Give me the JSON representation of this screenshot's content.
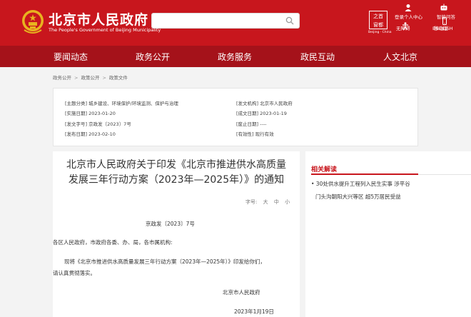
{
  "header": {
    "site_title": "北京市人民政府",
    "site_subtitle": "The People's Government of Beijing Municipality",
    "search_placeholder": "",
    "logo_chars": [
      "首",
      "之",
      "都",
      "窗"
    ],
    "logo_caption": "Beijing · China",
    "links": {
      "login": "登录个人中心",
      "accessible": "无障碍",
      "smart_q": "智能问答",
      "mobile": "移动版",
      "english": "ENGLISH"
    }
  },
  "nav": [
    "要闻动态",
    "政务公开",
    "政务服务",
    "政民互动",
    "人文北京"
  ],
  "breadcrumb": [
    "政务公开",
    "政策公开",
    "政策文件"
  ],
  "meta": {
    "topic": "[主题分类] 城乡建设、环境保护/环境监测、保护与治理",
    "issuer": "[发文机构] 北京市人民政府",
    "implement_date": "[实施日期] 2023-01-20",
    "written_date": "[成文日期] 2023-01-19",
    "doc_number": "[发文字号] 京政发〔2023〕7号",
    "abolish_date": "[废止日期] ----",
    "publish_date": "[发布日期] 2023-02-10",
    "validity": "[有效性] 现行有效"
  },
  "doc": {
    "title_line1": "北京市人民政府关于印发《北京市推进供水高质量",
    "title_line2": "发展三年行动方案（2023年—2025年）》的通知",
    "font_size_label": "字号:",
    "font_sizes": [
      "大",
      "中",
      "小"
    ],
    "number": "京政发〔2023〕7号",
    "recipients": "各区人民政府，市政府各委、办、局，各市属机构:",
    "body_line1": "现将《北京市推进供水高质量发展三年行动方案（2023年—2025年）》印发给你们，",
    "body_line2": "请认真贯彻落实。",
    "signature": "北京市人民政府",
    "date": "2023年1月19日"
  },
  "related": {
    "title": "相关解读",
    "items": [
      "• 30处供水提升工程列入民生实事 涉平谷",
      "门头沟朝阳大兴等区 超5万居民受益"
    ]
  }
}
